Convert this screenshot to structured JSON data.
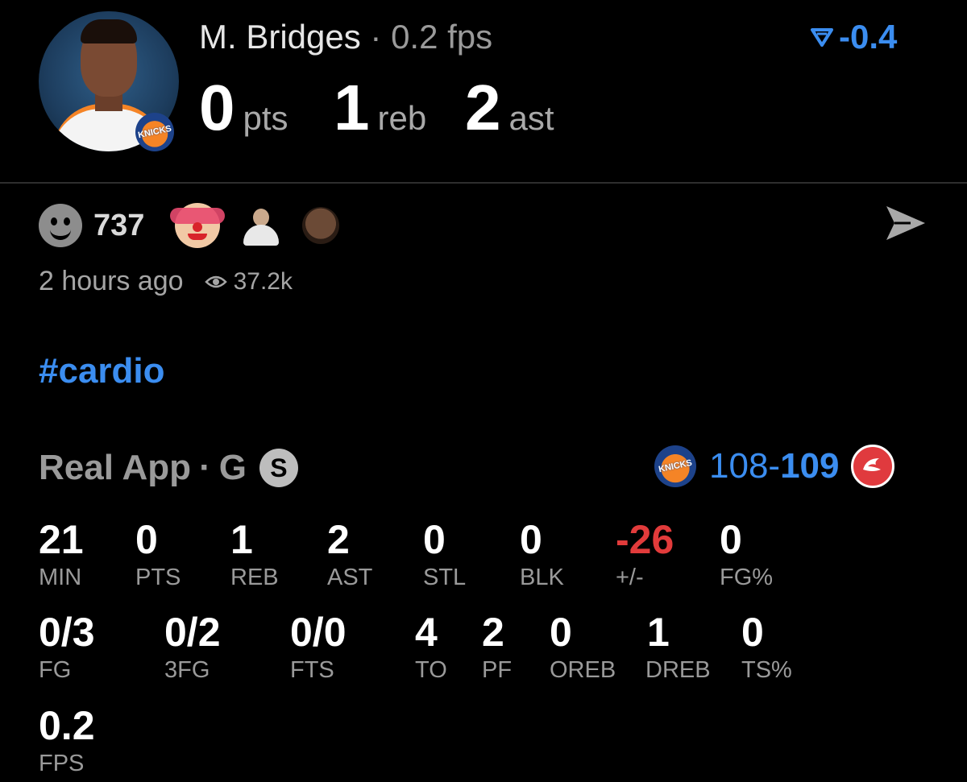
{
  "header": {
    "player_name": "M. Bridges",
    "separator": "·",
    "fps_label": "0.2 fps",
    "delta": "-0.4",
    "delta_icon": "down-triangle-icon",
    "top_stats": [
      {
        "value": "0",
        "unit": "pts"
      },
      {
        "value": "1",
        "unit": "reb"
      },
      {
        "value": "2",
        "unit": "ast"
      }
    ]
  },
  "reactions": {
    "count": "737",
    "icons": [
      "smile-icon",
      "clown-emoji",
      "person-emoji",
      "face-emoji"
    ],
    "share_icon": "send-icon"
  },
  "meta": {
    "time_ago": "2 hours ago",
    "views": "37.2k"
  },
  "hashtag": "#cardio",
  "game": {
    "source": "Real App",
    "separator": "·",
    "position": "G",
    "badge": "S",
    "score_home": "108",
    "score_dash": "-",
    "score_away": "109"
  },
  "stats_row1": [
    {
      "value": "21",
      "label": "MIN"
    },
    {
      "value": "0",
      "label": "PTS"
    },
    {
      "value": "1",
      "label": "REB"
    },
    {
      "value": "2",
      "label": "AST"
    },
    {
      "value": "0",
      "label": "STL"
    },
    {
      "value": "0",
      "label": "BLK"
    },
    {
      "value": "-26",
      "label": "+/-"
    },
    {
      "value": "0",
      "label": "FG%"
    }
  ],
  "stats_row2": [
    {
      "value": "0/3",
      "label": "FG"
    },
    {
      "value": "0/2",
      "label": "3FG"
    },
    {
      "value": "0/0",
      "label": "FTS"
    },
    {
      "value": "4",
      "label": "TO"
    },
    {
      "value": "2",
      "label": "PF"
    },
    {
      "value": "0",
      "label": "OREB"
    },
    {
      "value": "1",
      "label": "DREB"
    },
    {
      "value": "0",
      "label": "TS%"
    }
  ],
  "stats_row3": [
    {
      "value": "0.2",
      "label": "FPS"
    }
  ],
  "colors": {
    "accent": "#3b8df0",
    "negative": "#e23b3b",
    "background": "#000000",
    "muted": "#9a9a9a"
  }
}
